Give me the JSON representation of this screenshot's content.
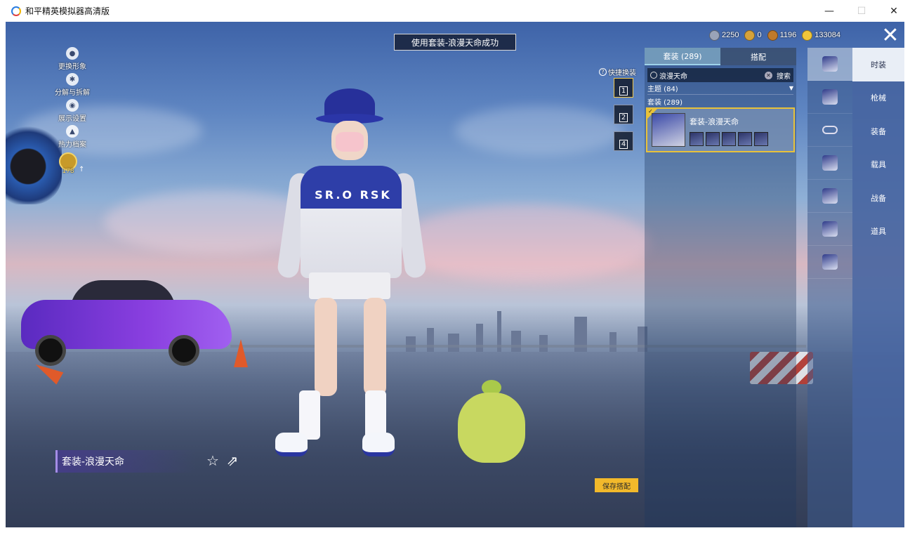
{
  "window": {
    "title": "和平精英模拟器高清版",
    "minimize": "—",
    "maximize": "☐",
    "close": "✕"
  },
  "toast": "使用套装-浪漫天命成功",
  "currencies": [
    {
      "icon": "silver-coin-icon",
      "value": "2250",
      "color": "#9aa3b8"
    },
    {
      "icon": "gold-coin-icon",
      "value": "0",
      "color": "#d6a23a"
    },
    {
      "icon": "bronze-coin-icon",
      "value": "1196",
      "color": "#c07a2a"
    },
    {
      "icon": "yellow-coin-icon",
      "value": "133084",
      "color": "#f0c63a"
    }
  ],
  "left_menu": [
    {
      "icon": "person-icon",
      "label": "更换形象"
    },
    {
      "icon": "gear-icon",
      "label": "分解与拆解"
    },
    {
      "icon": "eye-icon",
      "label": "展示设置"
    },
    {
      "icon": "flame-icon",
      "label": "热力档案"
    }
  ],
  "level": "178",
  "quick_switch": {
    "label": "快捷换装",
    "slots": [
      "1",
      "2",
      "4"
    ]
  },
  "outfit_name": "套装-浪漫天命",
  "character_text": "SR.O RSK",
  "save_button": "保存搭配",
  "panel": {
    "tabs": [
      {
        "label": "套装 (289)",
        "active": true
      },
      {
        "label": "搭配",
        "active": false
      }
    ],
    "search_value": "浪漫天命",
    "search_button": "搜索",
    "theme_row": "主题 (84)",
    "theme_arrow": "▼",
    "suits_section": "套装 (289)",
    "card": {
      "name": "套装-浪漫天命",
      "check": "✓",
      "mini_count": 5
    }
  },
  "icon_column": [
    "outfit-icon",
    "hat-icon",
    "glasses-icon",
    "weapon-skin-icon",
    "vehicle-icon",
    "parachute-icon",
    "gun-icon"
  ],
  "categories": [
    {
      "label": "时装",
      "active": true
    },
    {
      "label": "枪械",
      "active": false
    },
    {
      "label": "装备",
      "active": false
    },
    {
      "label": "载具",
      "active": false
    },
    {
      "label": "战备",
      "active": false
    },
    {
      "label": "道具",
      "active": false
    }
  ],
  "colors": {
    "accent": "#f2b92b",
    "selection": "#e8c23a",
    "tab_active": "#9ed2ea"
  }
}
